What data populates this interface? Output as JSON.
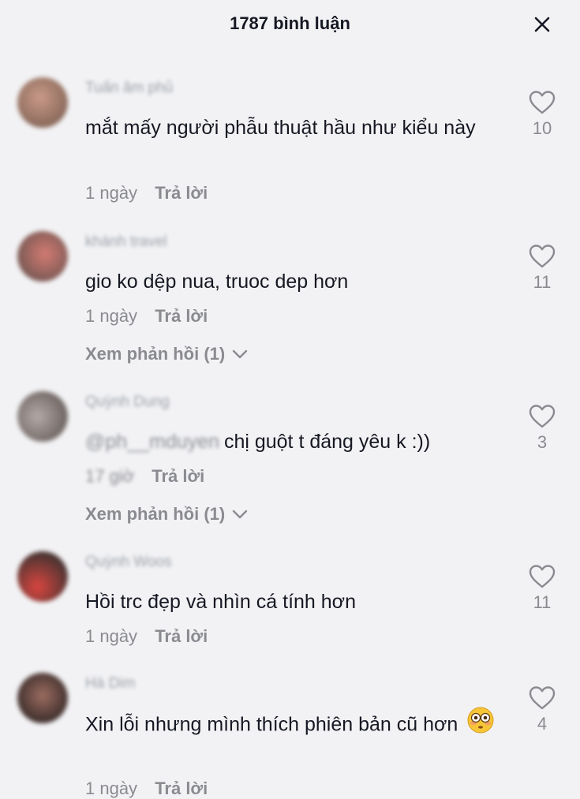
{
  "header": {
    "title": "1787 bình luận"
  },
  "comments": [
    {
      "username": "Tuấn âm phủ",
      "text": "mắt mấy người phẫu thuật hầu như kiểu này",
      "time": "1 ngày",
      "reply": "Trả lời",
      "likes": "10",
      "avatar_colors": [
        "#8b6a5c",
        "#c99a88"
      ]
    },
    {
      "username": "khánh travel",
      "text": "gio ko dệp nua, truoc dep hơn",
      "time": "1 ngày",
      "reply": "Trả lời",
      "likes": "11",
      "view_replies": "Xem phản hồi (1)",
      "avatar_colors": [
        "#7d5a55",
        "#d27b72"
      ]
    },
    {
      "username": "Quỳnh Dung",
      "mention": "@ph__mduyen",
      "text": "chị guột t đáng yêu k :))",
      "time": "17 giờ",
      "reply": "Trả lời",
      "likes": "3",
      "view_replies": "Xem phản hồi (1)",
      "avatar_colors": [
        "#6e6462",
        "#b3aaa6"
      ]
    },
    {
      "username": "Quỳnh Woos",
      "text": "Hồi trc đẹp và nhìn cá tính hơn",
      "time": "1 ngày",
      "reply": "Trả lời",
      "likes": "11",
      "avatar_colors": [
        "#4a3432",
        "#d8453f"
      ]
    },
    {
      "username": "Hà Dim",
      "text": "Xin lỗi nhưng mình thích phiên bản cũ hơn",
      "time": "1 ngày",
      "reply": "Trả lời",
      "likes": "4",
      "emoji": "flushed-face",
      "avatar_colors": [
        "#3e2f2c",
        "#9b6c60"
      ]
    }
  ],
  "colors": {
    "background": "#f2f2f4",
    "text": "#161823",
    "muted": "#8a8b91"
  }
}
